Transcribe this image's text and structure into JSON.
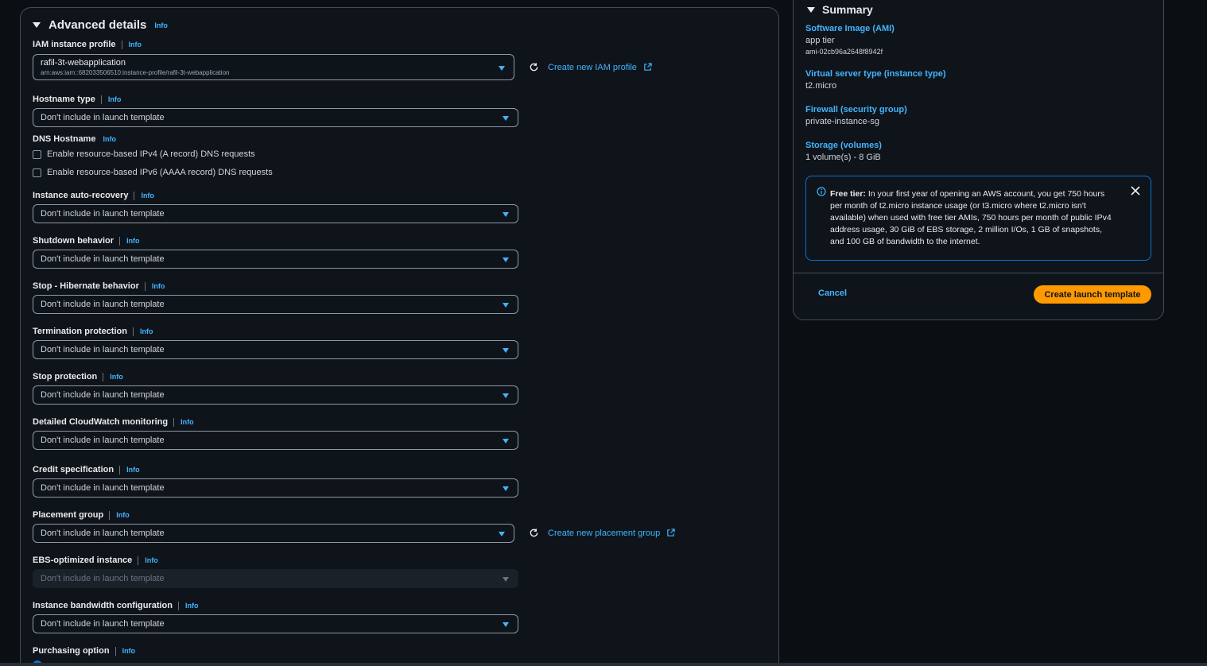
{
  "advanced": {
    "title": "Advanced details",
    "info": "Info",
    "iam": {
      "label": "IAM instance profile",
      "value": "rafil-3t-webapplication",
      "arn": "arn:aws:iam::682033506510:instance-profile/rafil-3t-webapplication",
      "create_link": "Create new IAM profile"
    },
    "hostname_type": {
      "label": "Hostname type",
      "value": "Don't include in launch template"
    },
    "dns_hostname": {
      "label": "DNS Hostname",
      "ipv4": "Enable resource-based IPv4 (A record) DNS requests",
      "ipv6": "Enable resource-based IPv6 (AAAA record) DNS requests"
    },
    "auto_recovery": {
      "label": "Instance auto-recovery",
      "value": "Don't include in launch template"
    },
    "shutdown": {
      "label": "Shutdown behavior",
      "value": "Don't include in launch template"
    },
    "hibernate": {
      "label": "Stop - Hibernate behavior",
      "value": "Don't include in launch template"
    },
    "termination": {
      "label": "Termination protection",
      "value": "Don't include in launch template"
    },
    "stop_protection": {
      "label": "Stop protection",
      "value": "Don't include in launch template"
    },
    "cloudwatch": {
      "label": "Detailed CloudWatch monitoring",
      "value": "Don't include in launch template"
    },
    "credit": {
      "label": "Credit specification",
      "value": "Don't include in launch template"
    },
    "placement": {
      "label": "Placement group",
      "value": "Don't include in launch template",
      "create_link": "Create new placement group"
    },
    "ebs": {
      "label": "EBS-optimized instance",
      "value": "Don't include in launch template"
    },
    "bandwidth": {
      "label": "Instance bandwidth configuration",
      "value": "Don't include in launch template"
    },
    "purchasing": {
      "label": "Purchasing option"
    }
  },
  "summary": {
    "title": "Summary",
    "ami_label": "Software Image (AMI)",
    "ami_value": "app tier",
    "ami_id": "ami-02cb96a2648f8942f",
    "type_label": "Virtual server type (instance type)",
    "type_value": "t2.micro",
    "firewall_label": "Firewall (security group)",
    "firewall_value": "private-instance-sg",
    "storage_label": "Storage (volumes)",
    "storage_value": "1 volume(s) - 8 GiB",
    "free_tier_bold": "Free tier:",
    "free_tier_text": " In your first year of opening an AWS account, you get 750 hours per month of t2.micro instance usage (or t3.micro where t2.micro isn't available) when used with free tier AMIs, 750 hours per month of public IPv4 address usage, 30 GiB of EBS storage, 2 million I/Os, 1 GB of snapshots, and 100 GB of bandwidth to the internet.",
    "cancel": "Cancel",
    "create": "Create launch template"
  },
  "colors": {
    "accent": "#42b4ff",
    "primary": "#ff9900",
    "panel": "#0f141a",
    "border": "#414d5c"
  }
}
